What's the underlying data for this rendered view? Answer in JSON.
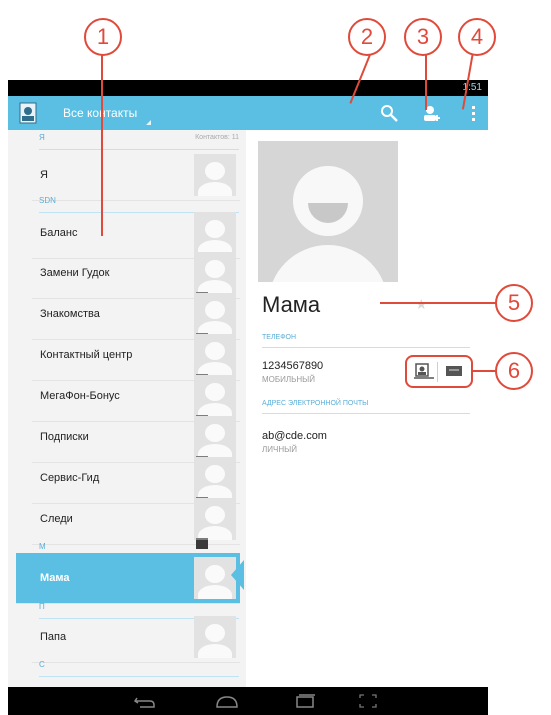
{
  "status_bar": {
    "clock": "1:51"
  },
  "action_bar": {
    "title": "Все контакты",
    "icons": [
      "contacts-app-icon",
      "search-icon",
      "add-contact-icon",
      "overflow-menu-icon"
    ]
  },
  "list": {
    "header_ya": "Я",
    "count_label": "Контактов: 11",
    "header_sdn": "SDN",
    "header_m": "М",
    "header_p": "П",
    "header_s": "С",
    "items": [
      {
        "name": "Я"
      },
      {
        "name": "Баланс"
      },
      {
        "name": "Замени Гудок"
      },
      {
        "name": "Знакомства"
      },
      {
        "name": "Контактный центр"
      },
      {
        "name": "МегаФон-Бонус"
      },
      {
        "name": "Подписки"
      },
      {
        "name": "Сервис-Гид"
      },
      {
        "name": "Следи"
      },
      {
        "name": "Мама"
      },
      {
        "name": "Папа"
      }
    ]
  },
  "detail": {
    "name": "Мама",
    "phone_section": "ТЕЛЕФОН",
    "phone": "1234567890",
    "phone_type": "МОБИЛЬНЫЙ",
    "email_section": "АДРЕС ЭЛЕКТРОННОЙ ПОЧТЫ",
    "email": "ab@cde.com",
    "email_type": "ЛИЧНЫЙ"
  },
  "callouts": [
    "1",
    "2",
    "3",
    "4",
    "5",
    "6"
  ],
  "colors": {
    "accent": "#5bbfe3",
    "callout": "#e04a3a"
  }
}
